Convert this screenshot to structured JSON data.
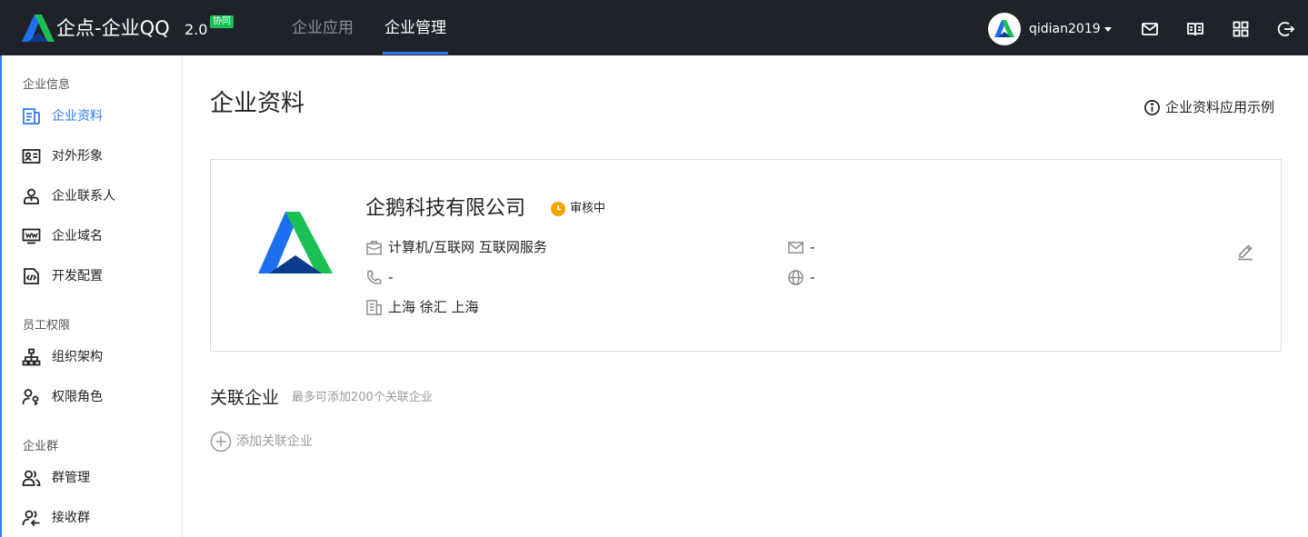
{
  "header": {
    "brand": "企点-企业QQ",
    "version": "2.0",
    "badge": "协同",
    "tabs": [
      {
        "label": "企业应用",
        "active": false
      },
      {
        "label": "企业管理",
        "active": true
      }
    ],
    "username": "qidian2019",
    "icons": [
      "mail-icon",
      "book-icon",
      "apps-grid-icon",
      "logout-icon"
    ],
    "colors": {
      "bar": "#1f2329",
      "accent": "#2d7cf6",
      "badge": "#19c155"
    }
  },
  "sidebar": {
    "groups": [
      {
        "title": "企业信息",
        "items": [
          {
            "label": "企业资料",
            "icon": "document-icon",
            "active": true
          },
          {
            "label": "对外形象",
            "icon": "id-card-icon",
            "active": false
          },
          {
            "label": "企业联系人",
            "icon": "contact-person-icon",
            "active": false
          },
          {
            "label": "企业域名",
            "icon": "domain-monitor-icon",
            "active": false
          },
          {
            "label": "开发配置",
            "icon": "code-file-icon",
            "active": false
          }
        ]
      },
      {
        "title": "员工权限",
        "items": [
          {
            "label": "组织架构",
            "icon": "org-chart-icon",
            "active": false
          },
          {
            "label": "权限角色",
            "icon": "user-role-icon",
            "active": false
          }
        ]
      },
      {
        "title": "企业群",
        "items": [
          {
            "label": "群管理",
            "icon": "group-users-icon",
            "active": false
          },
          {
            "label": "接收群",
            "icon": "receive-group-icon",
            "active": false
          }
        ]
      }
    ]
  },
  "main": {
    "title": "企业资料",
    "help_link": "企业资料应用示例",
    "company": {
      "name": "企鹅科技有限公司",
      "status": "审核中",
      "status_color": "#f5a300",
      "industry": "计算机/互联网 互联网服务",
      "phone": "-",
      "address": "上海 徐汇 上海",
      "email": "-",
      "website": "-"
    },
    "related": {
      "title": "关联企业",
      "hint": "最多可添加200个关联企业",
      "add_label": "添加关联企业"
    }
  }
}
